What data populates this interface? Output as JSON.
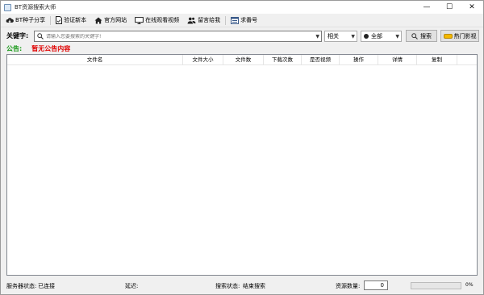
{
  "window": {
    "title": "BT资源搜索大师",
    "minimize": "—",
    "maximize": "☐",
    "close": "✕"
  },
  "toolbar": {
    "bt_share": "BT种子分享",
    "verify_version": "验证新本",
    "official_site": "官方网站",
    "watch_online": "在线观看视频",
    "leave_message": "留言给我",
    "request_code": "求番号"
  },
  "search": {
    "label": "关键字:",
    "placeholder": "请输入您要搜索的关键字!",
    "value": "",
    "sort_value": "相关",
    "scope_value": "全部",
    "search_button": "搜索",
    "hot_button": "热门影视"
  },
  "notice": {
    "label": "公告:",
    "text": "暂无公告内容"
  },
  "table": {
    "columns": [
      "文件名",
      "文件大小",
      "文件数",
      "下载次数",
      "是否视频",
      "操作",
      "详情",
      "复制"
    ],
    "rows": []
  },
  "status": {
    "server_label": "服务器状态:",
    "server_value": "已连接",
    "latency_label": "延迟:",
    "latency_value": "",
    "search_label": "搜索状态:",
    "search_value": "结束搜索",
    "count_label": "资源数量:",
    "count_value": "0",
    "progress_percent": 0,
    "progress_text": "0%"
  },
  "colors": {
    "notice_label": "#1a9a1a",
    "notice_text": "#e00000",
    "progress": "#06b025",
    "hot_button_icon": "#f5b800"
  }
}
